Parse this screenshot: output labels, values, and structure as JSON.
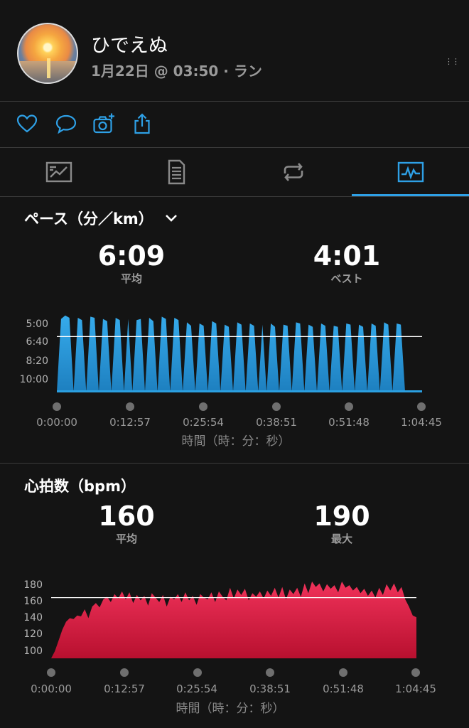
{
  "header": {
    "user_name": "ひでえぬ",
    "meta": "1月22日 @ 03:50 · ラン",
    "more_glyph": "⋮⋮"
  },
  "actions": [
    "heart-icon",
    "comment-icon",
    "camera-add-icon",
    "share-icon"
  ],
  "tabs": [
    {
      "name": "overview",
      "icon": "map-summary-icon",
      "active": false
    },
    {
      "name": "details",
      "icon": "document-list-icon",
      "active": false
    },
    {
      "name": "laps",
      "icon": "loop-arrows-icon",
      "active": false
    },
    {
      "name": "charts",
      "icon": "activity-chart-icon",
      "active": true
    }
  ],
  "pace": {
    "title": "ペース（分／km）",
    "avg_value": "6:09",
    "avg_label": "平均",
    "best_value": "4:01",
    "best_label": "ベスト",
    "y_ticks": [
      "5:00",
      "6:40",
      "8:20",
      "10:00"
    ],
    "x_ticks": [
      "0:00:00",
      "0:12:57",
      "0:25:54",
      "0:38:51",
      "0:51:48",
      "1:04:45"
    ],
    "x_label": "時間（時：分：秒）",
    "color": "#2b9fe0"
  },
  "heart_rate": {
    "title": "心拍数（bpm）",
    "avg_value": "160",
    "avg_label": "平均",
    "max_value": "190",
    "max_label": "最大",
    "y_ticks": [
      "180",
      "160",
      "140",
      "120",
      "100"
    ],
    "x_ticks": [
      "0:00:00",
      "0:12:57",
      "0:25:54",
      "0:38:51",
      "0:51:48",
      "1:04:45"
    ],
    "x_label": "時間（時：分：秒）",
    "color": "#e8284f"
  },
  "chart_data": [
    {
      "type": "area",
      "title": "ペース（分／km）",
      "xlabel": "時間（時：分：秒）",
      "ylabel": "",
      "x_range_seconds": [
        0,
        3885
      ],
      "y_unit": "min/km (inverted axis)",
      "average_pace": "6:09",
      "reference_line": "6:09",
      "pattern": "interval repeats, fast segments ~4:00–5:30 alternating with recovery ~10:00+",
      "series": [
        {
          "values_pace_min": [
            11.0,
            4.6,
            4.3,
            4.5,
            11.0,
            4.5,
            4.7,
            11.0,
            4.4,
            4.5,
            11.0,
            4.6,
            4.8,
            11.0,
            4.5,
            4.7,
            11.0,
            4.6,
            11.0,
            4.7,
            4.6,
            11.0,
            4.5,
            4.8,
            11.0,
            4.4,
            4.6,
            11.0,
            4.5,
            4.7,
            11.0,
            4.9,
            5.2,
            11.0,
            5.0,
            5.2,
            11.0,
            4.8,
            5.0,
            11.0,
            5.1,
            5.3,
            11.0,
            4.9,
            5.1,
            11.0,
            5.0,
            5.2,
            11.0,
            5.1,
            11.0,
            5.0,
            5.3,
            11.0,
            5.1,
            5.2,
            11.0,
            4.9,
            5.0,
            11.0,
            5.1,
            5.3,
            11.0,
            5.0,
            5.2,
            11.0,
            5.2,
            5.3,
            11.0,
            5.0,
            5.1,
            11.0,
            5.1,
            5.3,
            11.0,
            5.0,
            5.2,
            11.0,
            4.9,
            5.1,
            11.0,
            5.0,
            5.1,
            11.0
          ]
        }
      ]
    },
    {
      "type": "area",
      "title": "心拍数（bpm）",
      "xlabel": "時間（時：分：秒）",
      "ylabel": "",
      "x_range_seconds": [
        0,
        3885
      ],
      "ylim": [
        92,
        186
      ],
      "average": 160,
      "max": 190,
      "reference_line": 160,
      "series": [
        {
          "values": [
            92,
            100,
            112,
            124,
            133,
            137,
            136,
            140,
            139,
            147,
            137,
            150,
            154,
            149,
            158,
            161,
            155,
            164,
            159,
            167,
            158,
            166,
            154,
            163,
            157,
            162,
            151,
            165,
            160,
            155,
            163,
            150,
            161,
            158,
            164,
            155,
            166,
            157,
            162,
            152,
            164,
            160,
            158,
            166,
            155,
            167,
            161,
            157,
            171,
            159,
            169,
            163,
            170,
            157,
            165,
            161,
            167,
            159,
            168,
            162,
            171,
            160,
            172,
            158,
            169,
            164,
            171,
            161,
            176,
            165,
            178,
            172,
            176,
            167,
            175,
            170,
            174,
            166,
            178,
            171,
            174,
            168,
            172,
            165,
            170,
            162,
            168,
            160,
            171,
            163,
            175,
            168,
            176,
            166,
            172,
            158,
            150,
            140,
            138
          ]
        }
      ]
    }
  ]
}
